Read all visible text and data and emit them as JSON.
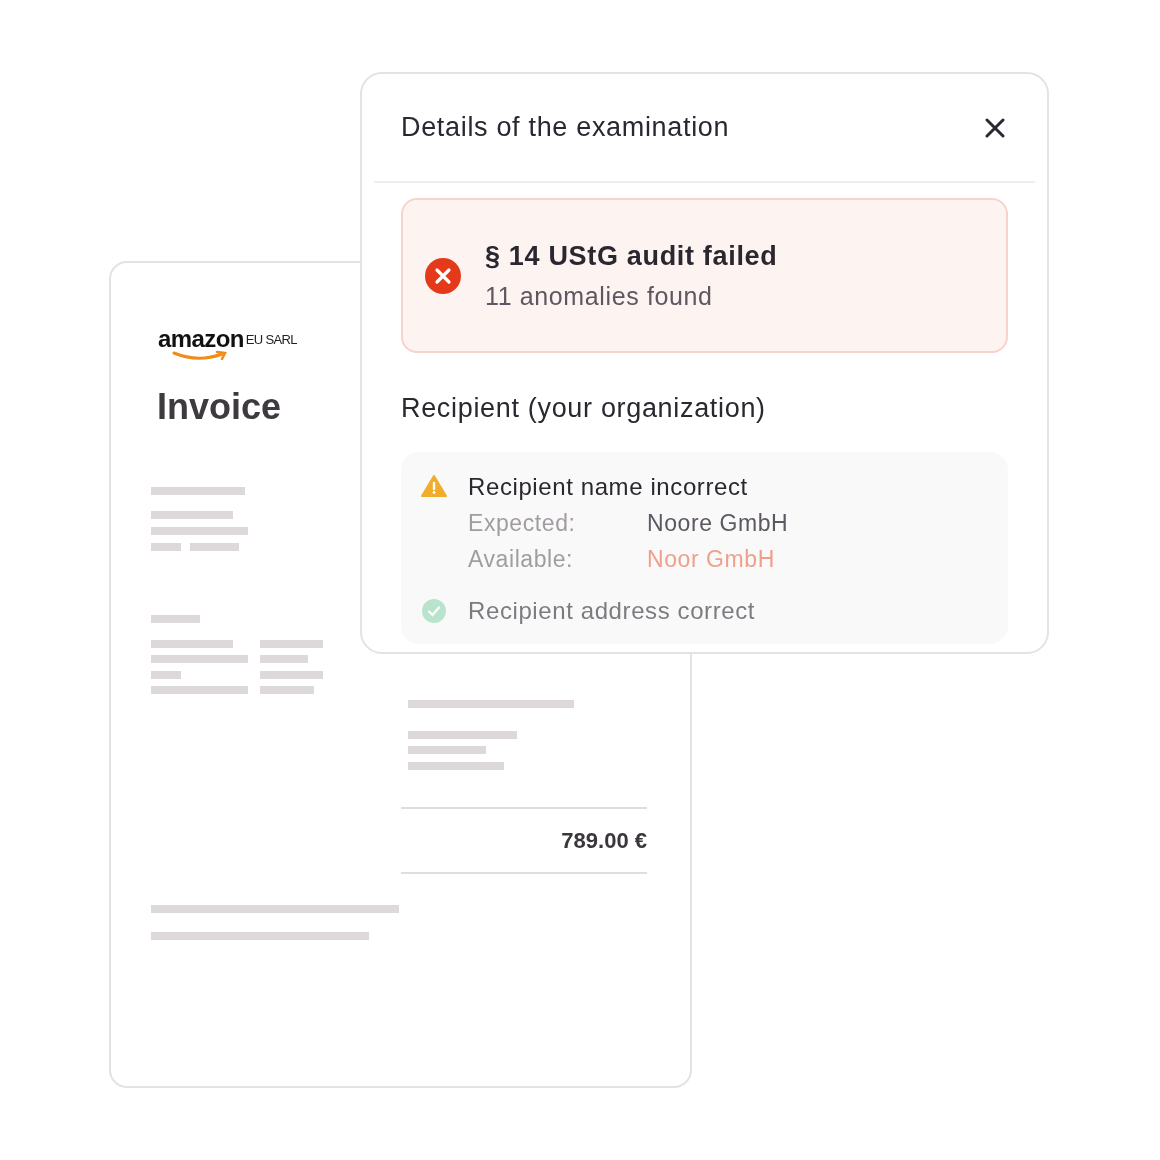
{
  "invoice": {
    "vendor_logo": "amazon",
    "vendor_suffix": "EU SARL",
    "title": "Invoice",
    "total": "789.00 €"
  },
  "dialog": {
    "title": "Details of the examination",
    "alert": {
      "kind": "error",
      "title": "§ 14 UStG audit failed",
      "subtitle": "11 anomalies found"
    },
    "section_title": "Recipient (your organization)",
    "checks": [
      {
        "kind": "warning",
        "title": "Recipient name incorrect",
        "details": [
          {
            "kind": "expected",
            "label": "Expected:",
            "value": "Noore GmbH"
          },
          {
            "kind": "actual",
            "label": "Available:",
            "value": "Noor GmbH"
          }
        ]
      },
      {
        "kind": "ok",
        "title": "Recipient address correct"
      }
    ]
  }
}
